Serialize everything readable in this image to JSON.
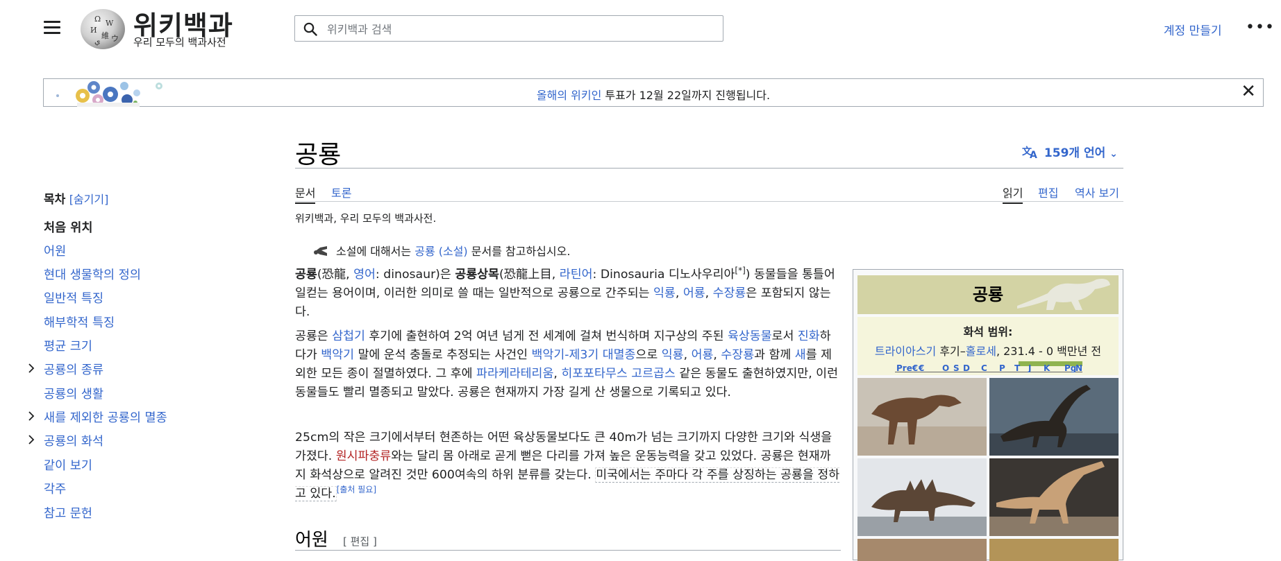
{
  "header": {
    "logo_title": "위키백과",
    "logo_subtitle": "우리 모두의 백과사전",
    "search_placeholder": "위키백과 검색",
    "create_account": "계정 만들기"
  },
  "banner": {
    "link_text": "올해의 위키인",
    "text": " 투표가 12월 22일까지 진행됩니다."
  },
  "toc": {
    "label": "목차",
    "hide": "[숨기기]",
    "items": [
      {
        "label": "처음 위치",
        "current": true
      },
      {
        "label": "어원"
      },
      {
        "label": "현대 생물학의 정의"
      },
      {
        "label": "일반적 특징"
      },
      {
        "label": "해부학적 특징"
      },
      {
        "label": "평균 크기"
      },
      {
        "label": "공룡의 종류",
        "expandable": true
      },
      {
        "label": "공룡의 생활"
      },
      {
        "label": "새를 제외한 공룡의 멸종",
        "expandable": true
      },
      {
        "label": "공룡의 화석",
        "expandable": true
      },
      {
        "label": "같이 보기"
      },
      {
        "label": "각주"
      },
      {
        "label": "참고 문헌"
      }
    ]
  },
  "article": {
    "title": "공룡",
    "languages": "159개 언어",
    "tabs_left": [
      "문서",
      "토론"
    ],
    "tabs_right": [
      "읽기",
      "편집",
      "역사 보기"
    ],
    "tagline": "위키백과, 우리 모두의 백과사전.",
    "hatnote": {
      "pre": "소설에 대해서는 ",
      "link": "공룡 (소설)",
      "post": " 문서를 참고하십시오."
    },
    "p1": {
      "t1": "공룡",
      "t2": "(恐龍, ",
      "t3": "영어",
      "t4": ": dinosaur)은 ",
      "t5": "공룡상목",
      "t6": "(恐龍上目, ",
      "t7": "라틴어",
      "t8": ": Dinosauria 디노사우리아",
      "t9": "[*]",
      "t10": ") 동물들을 통틀어 일컫는 용어이며, 이러한 의미로 쓸 때는 일반적으로 공룡으로 간주되는 ",
      "t11": "익룡",
      "t12": ", ",
      "t13": "어룡",
      "t14": ", ",
      "t15": "수장룡",
      "t16": "은 포함되지 않는다."
    },
    "p2": {
      "t1": "공룡은 ",
      "t2": "삼첩기",
      "t3": " 후기에 출현하여 2억 여년 넘게 전 세계에 걸쳐 번식하며 지구상의 주된 ",
      "t4": "육상동물",
      "t5": "로서 ",
      "t6": "진화",
      "t7": "하다가 ",
      "t8": "백악기",
      "t9": " 말에 운석 충돌로 추정되는 사건인 ",
      "t10": "백악기-제3기 대멸종",
      "t11": "으로 ",
      "t12": "익룡",
      "t13": ", ",
      "t14": "어룡",
      "t15": ", ",
      "t16": "수장룡",
      "t17": "과 함께 ",
      "t18": "새",
      "t19": "를 제외한 모든 종이 절멸하였다. 그 후에 ",
      "t20": "파라케라테리움",
      "t21": ", ",
      "t22": "히포포타무스 고르곱스",
      "t23": " 같은 동물도 출현하였지만, 이런 동물들도 빨리 멸종되고 말았다. 공룡은 현재까지 가장 길게 산 생물으로 기록되고 있다."
    },
    "p3": {
      "t1": "25cm의 작은 크기에서부터 현존하는 어떤 육상동물보다도 큰 40m가 넘는 크기까지 다양한 크기와 식생을 가졌다. ",
      "t2": "원시파충류",
      "t3": "와는 달리 몸 아래로 곧게 뻗은 다리를 가져 높은 운동능력을 갖고 있었다. 공룡은 현재까지 화석상으로 알려진 것만 600여속의 하위 분류를 갖는다. ",
      "t4": "미국에서는 주마다 각 주를 상징하는 공룡을 정하고 있다.",
      "t5": "[출처 필요]"
    },
    "section_title": "어원",
    "section_edit": "[ 편집 ]"
  },
  "infobox": {
    "title": "공룡",
    "range_label": "화석 범위:",
    "range_link1": "트라이아스기",
    "range_mid": " 후기–",
    "range_link2": "홀로세",
    "range_tail": ", 231.4 - 0 백만년 전",
    "timeline_labels": [
      "Pre€",
      "€",
      "O",
      "S",
      "D",
      "C",
      "P",
      "T",
      "J",
      "K",
      "Pg",
      "N"
    ]
  }
}
